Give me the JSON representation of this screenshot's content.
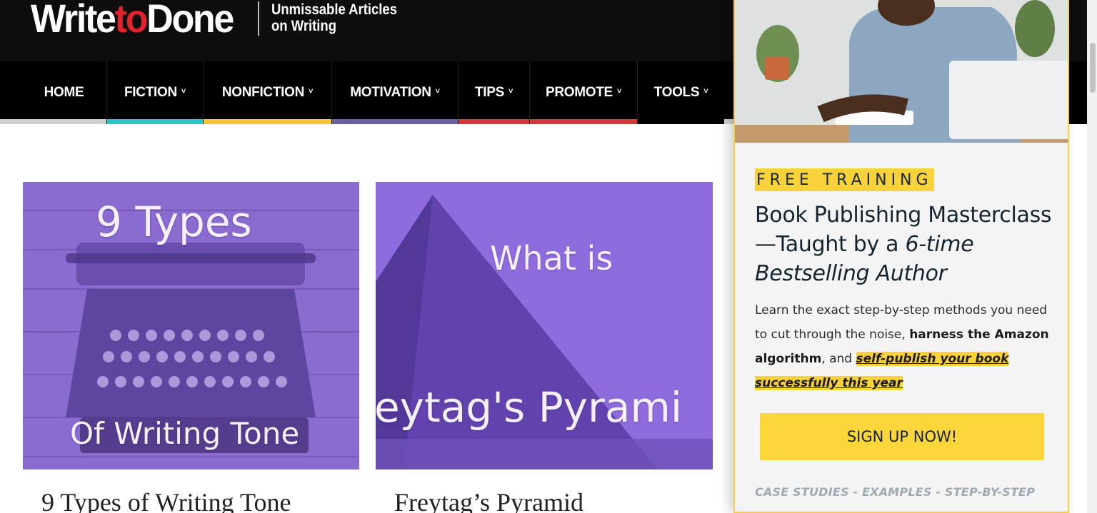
{
  "header": {
    "logo_part1": "Write",
    "logo_part2": "to",
    "logo_part3": "Done",
    "tagline_line1": "Unmissable Articles",
    "tagline_line2": "on Writing"
  },
  "nav": {
    "items": [
      {
        "label": "HOME",
        "has_dropdown": false,
        "accent": "#cfcfcf"
      },
      {
        "label": "FICTION",
        "has_dropdown": true,
        "accent": "#2ec4c6"
      },
      {
        "label": "NONFICTION",
        "has_dropdown": true,
        "accent": "#f6c730"
      },
      {
        "label": "MOTIVATION",
        "has_dropdown": true,
        "accent": "#6b5fa0"
      },
      {
        "label": "TIPS",
        "has_dropdown": true,
        "accent": "#d9373a"
      },
      {
        "label": "PROMOTE",
        "has_dropdown": true,
        "accent": "#d9373a"
      },
      {
        "label": "TOOLS",
        "has_dropdown": true,
        "accent": "#cfcfcf"
      }
    ],
    "chevron": "˅"
  },
  "articles": [
    {
      "image_text_line1": "9 Types",
      "image_text_line2": "Of Writing Tone",
      "title": "9 Types of Writing Tone"
    },
    {
      "image_text_line1": "What is",
      "image_text_line2": "eytag's Pyrami",
      "title": "Freytag’s Pyramid"
    }
  ],
  "popup": {
    "kicker": "FREE TRAINING",
    "headline_plain": "Book Publishing Masterclass—Taught by a",
    "headline_italic": "6-time Bestselling Author",
    "body_1": "Learn the exact step-by-step methods you need to cut through the noise,",
    "body_bold": "harness the Amazon algorithm",
    "body_2": ", and",
    "body_highlight": "self-publish your book successfully this year",
    "cta_label": "SIGN UP NOW!",
    "footer_note": "CASE STUDIES - EXAMPLES - STEP-BY-STEP"
  },
  "colors": {
    "brand_red": "#e0242f",
    "accent_yellow": "#f8d23a",
    "card_purple": "#8a6bd0"
  }
}
